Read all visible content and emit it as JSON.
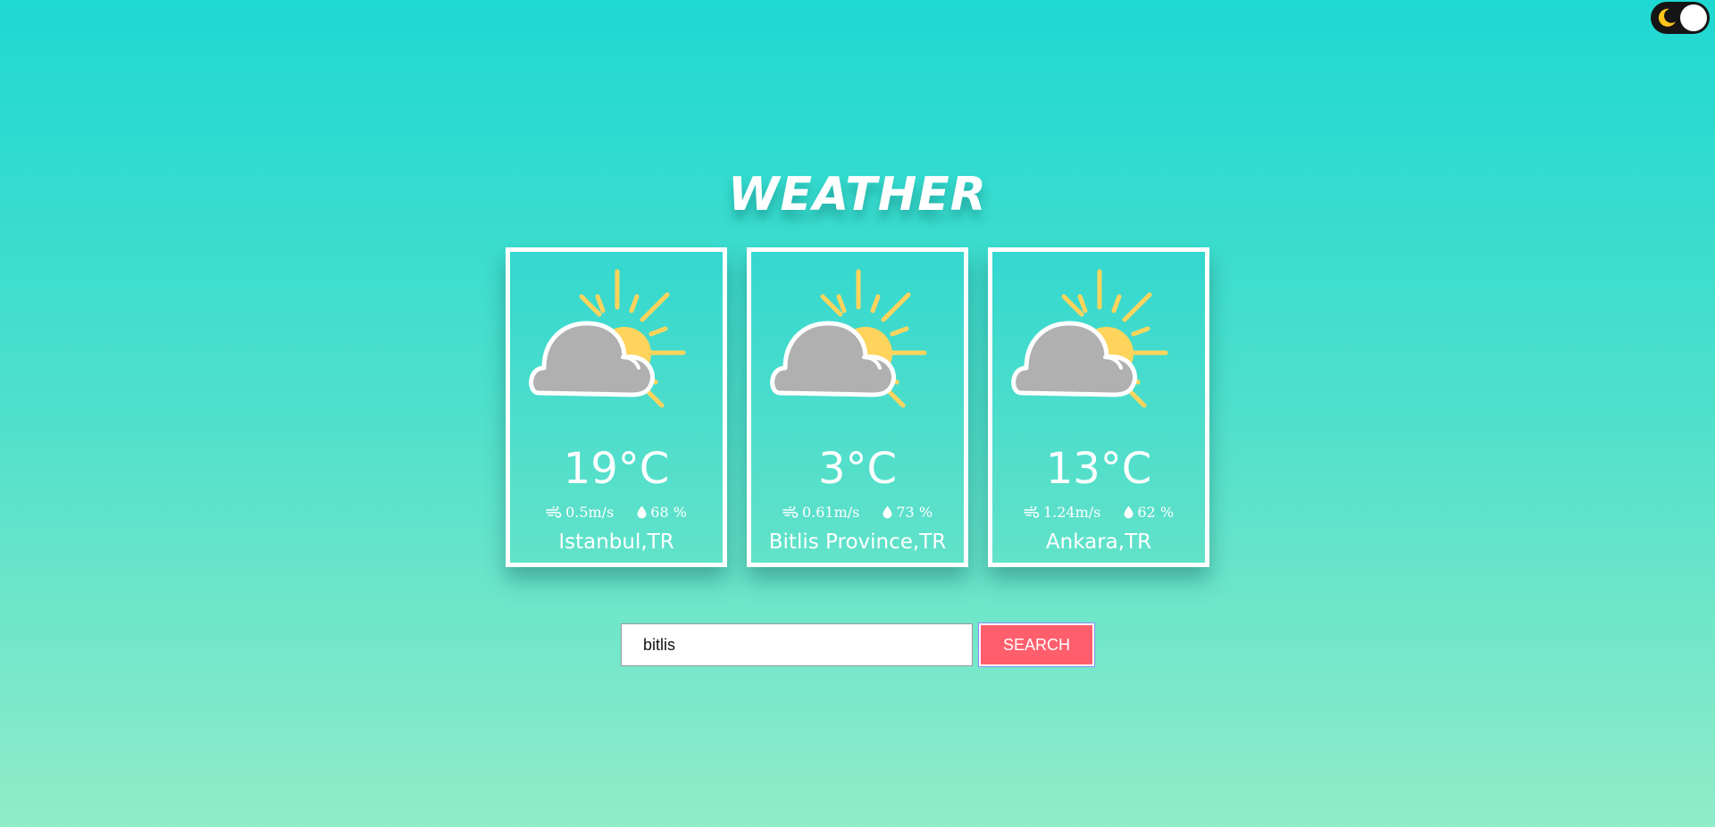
{
  "app": {
    "title": "WEATHER",
    "theme_toggle": {
      "icon": "moon-icon",
      "state": "light"
    }
  },
  "colors": {
    "card_bg_top": "#34d8cf",
    "card_bg_bottom": "#62e2c9",
    "sun": "#ffd45c",
    "cloud": "#b0b0b0",
    "button": "#ff5f6d"
  },
  "cards": [
    {
      "icon": "partly-cloudy-icon",
      "temp": "19°C",
      "wind": "0.5m/s",
      "humidity": "68 %",
      "city": "Istanbul,TR"
    },
    {
      "icon": "partly-cloudy-icon",
      "temp": "3°C",
      "wind": "0.61m/s",
      "humidity": "73 %",
      "city": "Bitlis Province,TR"
    },
    {
      "icon": "partly-cloudy-icon",
      "temp": "13°C",
      "wind": "1.24m/s",
      "humidity": "62 %",
      "city": "Ankara,TR"
    }
  ],
  "search": {
    "value": "bitlis",
    "placeholder": "",
    "button_label": "SEARCH"
  }
}
